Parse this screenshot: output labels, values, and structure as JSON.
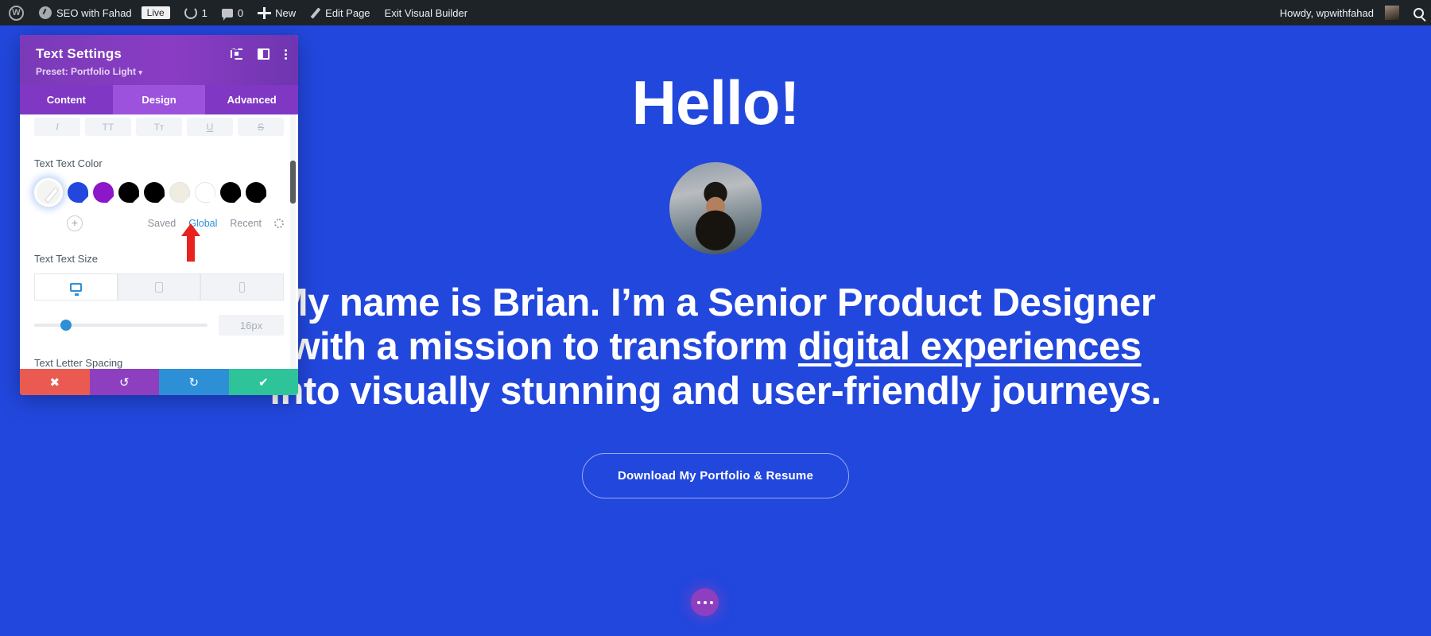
{
  "admin_bar": {
    "items": [
      {
        "name": "wp-logo",
        "label": ""
      },
      {
        "name": "site-name",
        "label": "SEO with Fahad"
      },
      {
        "name": "live",
        "label": "Live"
      },
      {
        "name": "updates",
        "label": "1"
      },
      {
        "name": "comments",
        "label": "0"
      },
      {
        "name": "new",
        "label": "New"
      },
      {
        "name": "edit-page",
        "label": "Edit Page"
      },
      {
        "name": "exit-vb",
        "label": "Exit Visual Builder"
      }
    ],
    "site_name": "SEO with Fahad",
    "live_badge": "Live",
    "updates_count": "1",
    "comments_count": "0",
    "new_label": "New",
    "edit_page_label": "Edit Page",
    "exit_builder_label": "Exit Visual Builder",
    "howdy": "Howdy, wpwithfahad",
    "search_icon": "search-icon"
  },
  "settings_modal": {
    "title": "Text Settings",
    "preset_label": "Preset: Portfolio Light",
    "preset_caret": "▾",
    "header_icons": [
      "focus-icon",
      "panel-layout-icon",
      "more-options-icon"
    ],
    "tabs": [
      {
        "label": "Content",
        "active": false
      },
      {
        "label": "Design",
        "active": true
      },
      {
        "label": "Advanced",
        "active": false
      }
    ],
    "format_buttons": [
      {
        "name": "italic-button",
        "label": "I"
      },
      {
        "name": "uppercase-button",
        "label": "TT"
      },
      {
        "name": "capitalize-button",
        "label": "Tᴛ"
      },
      {
        "name": "underline-button",
        "label": "U"
      },
      {
        "name": "strikethrough-button",
        "label": "S"
      }
    ],
    "text_color": {
      "label": "Text Text Color",
      "swatches": [
        {
          "name": "eyedropper",
          "color": "#f4f4f2"
        },
        {
          "name": "blue",
          "color": "#2247dd"
        },
        {
          "name": "purple",
          "color": "#8d16c9"
        },
        {
          "name": "black-1",
          "color": "#000000"
        },
        {
          "name": "black-2",
          "color": "#000000"
        },
        {
          "name": "cream",
          "color": "#f0ece0"
        },
        {
          "name": "white",
          "color": "#ffffff"
        },
        {
          "name": "black-3",
          "color": "#000000"
        },
        {
          "name": "black-4",
          "color": "#000000"
        }
      ],
      "add_label": "+",
      "palette_tabs": [
        {
          "label": "Saved",
          "active": false
        },
        {
          "label": "Global",
          "active": true
        },
        {
          "label": "Recent",
          "active": false
        }
      ],
      "settings_icon": "gear-icon"
    },
    "text_size": {
      "label": "Text Text Size",
      "devices": [
        {
          "name": "desktop",
          "icon": "monitor-icon",
          "active": true
        },
        {
          "name": "tablet",
          "icon": "tablet-icon",
          "active": false
        },
        {
          "name": "phone",
          "icon": "phone-icon",
          "active": false
        }
      ],
      "value": "16px",
      "slider_percent": 15
    },
    "letter_spacing": {
      "label": "Text Letter Spacing"
    },
    "footer_buttons": [
      {
        "name": "cancel-button",
        "glyph": "✖",
        "color": "#ea5a50"
      },
      {
        "name": "undo-button",
        "glyph": "↺",
        "color": "#8d3fc0"
      },
      {
        "name": "redo-button",
        "glyph": "↻",
        "color": "#2d8fd5"
      },
      {
        "name": "save-button",
        "glyph": "✔",
        "color": "#2fc39a"
      }
    ],
    "accent_header": "#8a3dc4",
    "accent_active_tab": "#9d52de"
  },
  "page": {
    "background_color": "#2247dd",
    "heading": "Hello!",
    "paragraph_part1": "My name is Brian. I’m a Senior Product Designer with a mission to transform ",
    "paragraph_link": "digital experiences",
    "paragraph_part2": " into visually stunning and user-friendly journeys.",
    "cta_label": "Download My Portfolio & Resume",
    "fab_label": "more-options",
    "avatar_name": "profile-avatar"
  }
}
